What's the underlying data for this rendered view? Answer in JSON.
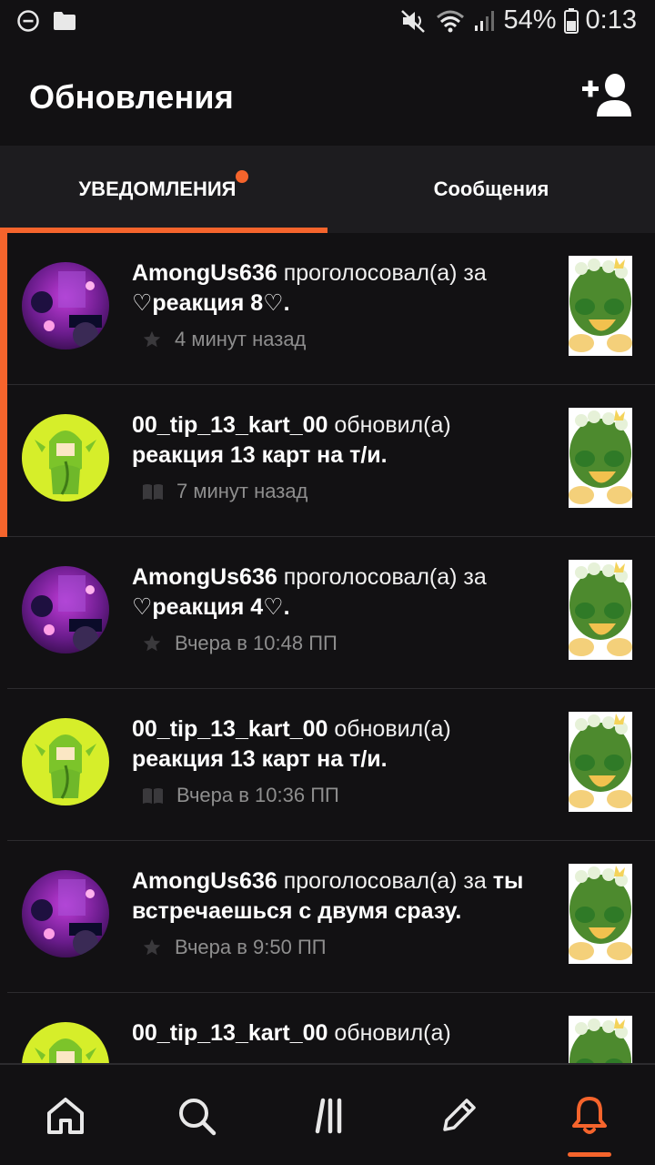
{
  "statusbar": {
    "battery": "54%",
    "time": "0:13"
  },
  "header": {
    "title": "Обновления"
  },
  "tabs": [
    {
      "label": "УВЕДОМЛЕНИЯ",
      "active": true,
      "has_badge": true
    },
    {
      "label": "Сообщения",
      "active": false
    }
  ],
  "notifications": [
    {
      "user": "AmongUs636",
      "action": "проголосовал(а) за",
      "story": "♡реакция 8♡.",
      "time": "4 минут назад",
      "meta_icon": "star-icon",
      "avatar": "purple-avatar",
      "unread": true
    },
    {
      "user": "00_tip_13_kart_00",
      "action": "обновил(а)",
      "story": "реакция 13 карт на т/и.",
      "time": "7 минут назад",
      "meta_icon": "book-icon",
      "avatar": "green-avatar",
      "unread": true
    },
    {
      "user": "AmongUs636",
      "action": "проголосовал(а) за",
      "story": "♡реакция 4♡.",
      "time": "Вчера в 10:48 ПП",
      "meta_icon": "star-icon",
      "avatar": "purple-avatar",
      "unread": false
    },
    {
      "user": "00_tip_13_kart_00",
      "action": "обновил(а)",
      "story": "реакция 13 карт на т/и.",
      "time": "Вчера в 10:36 ПП",
      "meta_icon": "book-icon",
      "avatar": "green-avatar",
      "unread": false
    },
    {
      "user": "AmongUs636",
      "action": "проголосовал(а) за",
      "story": "ты встречаешься с двумя сразу.",
      "time": "Вчера в 9:50 ПП",
      "meta_icon": "star-icon",
      "avatar": "purple-avatar",
      "unread": false
    },
    {
      "user": "00_tip_13_kart_00",
      "action": "обновил(а)",
      "story": "",
      "time": "",
      "meta_icon": "book-icon",
      "avatar": "green-avatar",
      "unread": false
    }
  ],
  "bottom_nav": [
    {
      "name": "home-icon",
      "active": false
    },
    {
      "name": "search-icon",
      "active": false
    },
    {
      "name": "library-icon",
      "active": false
    },
    {
      "name": "write-icon",
      "active": false
    },
    {
      "name": "bell-icon",
      "active": true
    }
  ],
  "colors": {
    "accent": "#f5642c",
    "background": "#121113",
    "tab_bg": "#1d1c1f"
  }
}
